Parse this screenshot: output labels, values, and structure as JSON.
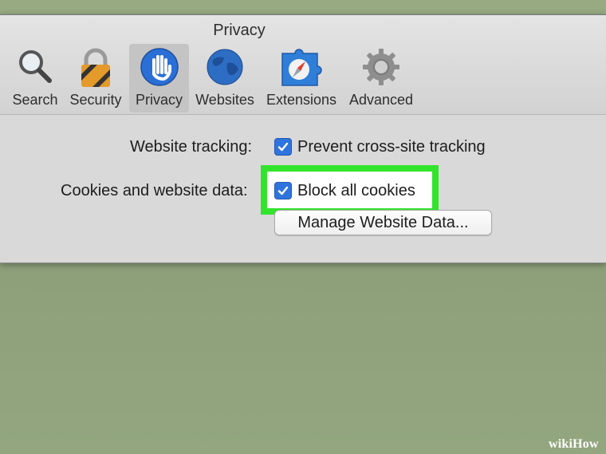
{
  "window": {
    "title": "Privacy"
  },
  "toolbar": {
    "tabs": [
      {
        "label": "Search",
        "icon": "search-icon"
      },
      {
        "label": "Security",
        "icon": "lock-icon"
      },
      {
        "label": "Privacy",
        "icon": "hand-icon",
        "selected": true
      },
      {
        "label": "Websites",
        "icon": "globe-icon"
      },
      {
        "label": "Extensions",
        "icon": "puzzle-compass-icon"
      },
      {
        "label": "Advanced",
        "icon": "gear-icon"
      }
    ]
  },
  "privacy": {
    "website_tracking_label": "Website tracking:",
    "prevent_tracking_label": "Prevent cross-site tracking",
    "prevent_tracking_checked": true,
    "cookies_label": "Cookies and website data:",
    "block_cookies_label": "Block all cookies",
    "block_cookies_checked": true,
    "manage_button_label": "Manage Website Data..."
  },
  "colors": {
    "highlight": "#32e42c",
    "checkbox": "#2f74de",
    "backdrop": "#93a87e"
  },
  "watermark": "wikiHow"
}
